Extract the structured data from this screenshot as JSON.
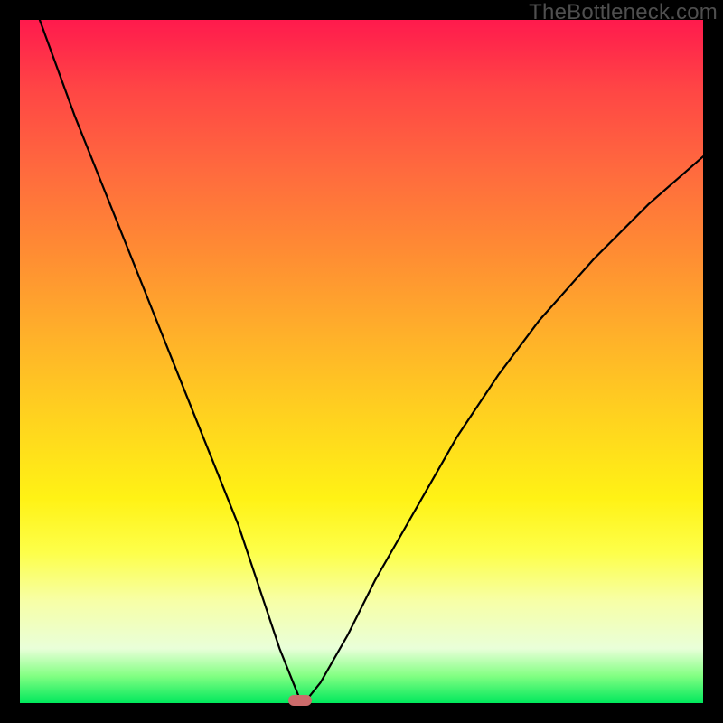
{
  "watermark": "TheBottleneck.com",
  "chart_data": {
    "type": "line",
    "title": "",
    "xlabel": "",
    "ylabel": "",
    "xlim": [
      0,
      100
    ],
    "ylim": [
      0,
      100
    ],
    "grid": false,
    "legend": false,
    "series": [
      {
        "name": "bottleneck-curve",
        "x": [
          0,
          4,
          8,
          12,
          16,
          20,
          24,
          28,
          32,
          36,
          38,
          40,
          41,
          42,
          44,
          48,
          52,
          56,
          60,
          64,
          70,
          76,
          84,
          92,
          100
        ],
        "y": [
          108,
          97,
          86,
          76,
          66,
          56,
          46,
          36,
          26,
          14,
          8,
          3,
          0.5,
          0.5,
          3,
          10,
          18,
          25,
          32,
          39,
          48,
          56,
          65,
          73,
          80
        ]
      }
    ],
    "annotations": [
      {
        "name": "minimum-marker",
        "x": 41,
        "y": 0.4
      }
    ],
    "background": {
      "type": "vertical-gradient",
      "stops": [
        {
          "pos": 0,
          "color": "#ff1a4d"
        },
        {
          "pos": 50,
          "color": "#ffd21f"
        },
        {
          "pos": 80,
          "color": "#fdff4a"
        },
        {
          "pos": 100,
          "color": "#00e85c"
        }
      ]
    }
  }
}
